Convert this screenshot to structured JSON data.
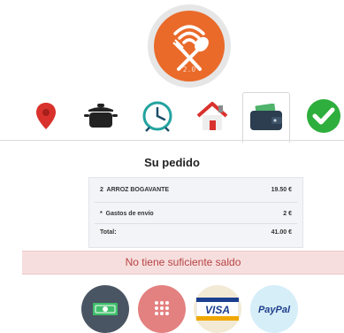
{
  "logo": {
    "version": "2.0"
  },
  "steps": [
    {
      "name": "location"
    },
    {
      "name": "cooking-pot"
    },
    {
      "name": "clock"
    },
    {
      "name": "home"
    },
    {
      "name": "wallet",
      "active": true
    },
    {
      "name": "checkmark"
    }
  ],
  "order": {
    "title": "Su pedido",
    "items": [
      {
        "qty": "2",
        "name": "ARROZ BOGAVANTE",
        "price": "19.50 €"
      },
      {
        "qty": "*",
        "name": "Gastos de envío",
        "price": "2 €"
      }
    ],
    "total_label": "Total:",
    "total_value": "41.00 €"
  },
  "alert": {
    "message": "No tiene suficiente saldo"
  },
  "payment_methods": [
    {
      "name": "cash",
      "color": "#4a5563"
    },
    {
      "name": "card-keypad",
      "color": "#e38080"
    },
    {
      "name": "visa",
      "color": "#f2ead4",
      "label": "VISA"
    },
    {
      "name": "paypal",
      "color": "#d6eef8",
      "label": "PayPal"
    }
  ]
}
